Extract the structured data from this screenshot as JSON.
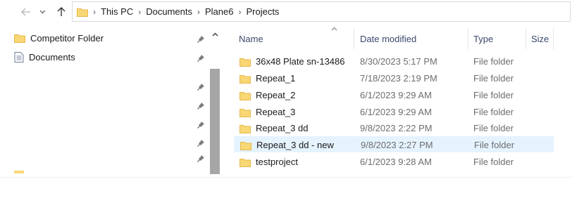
{
  "colors": {
    "folder": "#f8d775",
    "folder_dark": "#e8b847",
    "hover_row": "#e5f3ff",
    "header_text": "#3a4a6b"
  },
  "toolbar": {
    "back_icon": "arrow-left-icon",
    "recent_icon": "chevron-down-icon",
    "up_icon": "arrow-up-icon"
  },
  "breadcrumb": [
    "This PC",
    "Documents",
    "Plane6",
    "Projects"
  ],
  "nav_pane": {
    "items": [
      {
        "label": "Competitor Folder",
        "icon": "folder-icon"
      },
      {
        "label": "Documents",
        "icon": "documents-icon"
      }
    ]
  },
  "file_list": {
    "columns": {
      "name": "Name",
      "date": "Date modified",
      "type": "Type",
      "size": "Size"
    },
    "rows": [
      {
        "name": "36x48 Plate sn-13486",
        "date": "8/30/2023 5:17 PM",
        "type": "File folder"
      },
      {
        "name": "Repeat_1",
        "date": "7/18/2023 2:19 PM",
        "type": "File folder"
      },
      {
        "name": "Repeat_2",
        "date": "6/1/2023 9:29 AM",
        "type": "File folder"
      },
      {
        "name": "Repeat_3",
        "date": "6/1/2023 9:29 AM",
        "type": "File folder"
      },
      {
        "name": "Repeat_3 dd",
        "date": "9/8/2023 2:22 PM",
        "type": "File folder"
      },
      {
        "name": "Repeat_3 dd - new",
        "date": "9/8/2023 2:27 PM",
        "type": "File folder",
        "hover": true
      },
      {
        "name": "testproject",
        "date": "6/1/2023 9:28 AM",
        "type": "File folder"
      }
    ]
  }
}
